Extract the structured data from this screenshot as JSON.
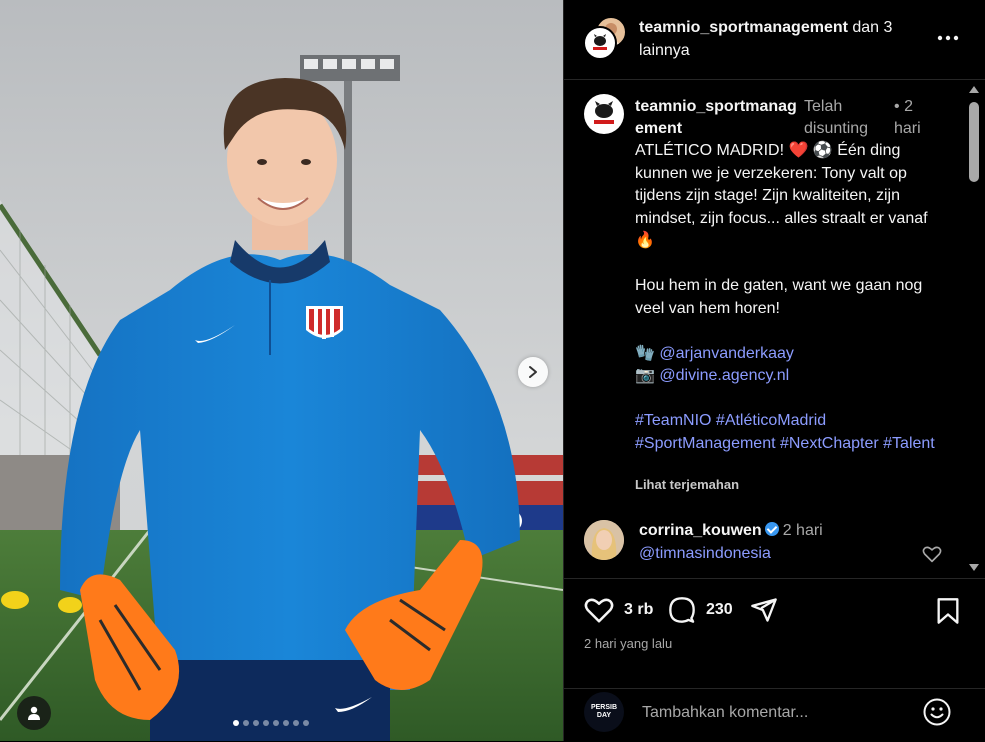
{
  "header": {
    "username": "teamnio_sportmanagement",
    "suffix": " dan 3 lainnya",
    "more_icon": "more-horizontal-icon",
    "logo_text": "TEAM NIO"
  },
  "carousel": {
    "total": 8,
    "active_index": 0,
    "next_icon": "chevron-right-icon",
    "tag_icon": "user-tag-icon"
  },
  "caption": {
    "username": "teamnio_sportmanagement",
    "edited_label": "Telah disunting",
    "separator": "•",
    "time": "2 hari",
    "line1": "ATLÉTICO MADRID! ❤️ ⚽ Één ding kunnen we je verzekeren: Tony valt op tijdens zijn stage! Zijn kwaliteiten, zijn mindset, zijn focus... alles straalt er vanaf 🔥",
    "line2": "Hou hem in de gaten, want we gaan nog veel van hem horen!",
    "credit1_emoji": "🧤",
    "credit1_handle": "@arjanvanderkaay",
    "credit2_emoji": "📷",
    "credit2_handle": "@divine.agency.nl",
    "hashtags": "#TeamNIO #AtléticoMadrid #SportManagement #NextChapter #Talent",
    "translate_label": "Lihat terjemahan"
  },
  "comments": [
    {
      "username": "corrina_kouwen",
      "verified": true,
      "time": "2 hari",
      "text": "@timnasindonesia",
      "like_icon": "heart-icon"
    }
  ],
  "actions": {
    "like_icon": "heart-icon",
    "like_count": "3 rb",
    "comment_icon": "comment-icon",
    "comment_count": "230",
    "share_icon": "send-icon",
    "save_icon": "bookmark-icon",
    "posted": "2 hari yang lalu"
  },
  "composer": {
    "avatar_text_1": "PERSIB",
    "avatar_text_2": "DAY",
    "placeholder": "Tambahkan komentar...",
    "emoji_icon": "emoji-icon"
  },
  "colors": {
    "background": "#000000",
    "link": "#8c9cff",
    "muted": "#a8a8a8",
    "jersey": "#1a84d6",
    "gloves": "#ff7a1a"
  }
}
